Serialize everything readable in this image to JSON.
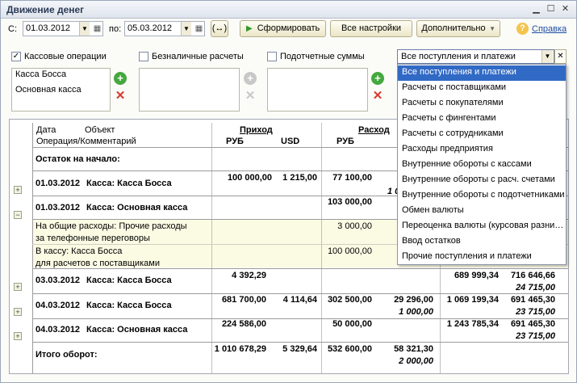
{
  "window": {
    "title": "Движение денег",
    "min_icon": "minimize-icon",
    "max_icon": "maximize-icon",
    "close_icon": "close-icon"
  },
  "toolbar": {
    "from_label": "С:",
    "from_date": "01.03.2012",
    "to_label": "по:",
    "to_date": "05.03.2012",
    "period_button": "(↔)",
    "generate_label": "Сформировать",
    "all_settings_label": "Все настройки",
    "additional_label": "Дополнительно",
    "help_label": "Справка"
  },
  "filters": {
    "cash_label": "Кассовые операции",
    "cash_checked": "✓",
    "cash_items": [
      "Касса Босса",
      "Основная касса"
    ],
    "noncash_label": "Безналичные расчеты",
    "accountable_label": "Подотчетные суммы",
    "combo_value": "Все поступления и платежи"
  },
  "dropdown": {
    "options": [
      "Все поступления и платежи",
      "Расчеты с поставщиками",
      "Расчеты с покупателями",
      "Расчеты с фингентами",
      "Расчеты с сотрудниками",
      "Расходы предприятия",
      "Внутренние обороты с кассами",
      "Внутренние обороты с расч. счетами",
      "Внутренние обороты с подотчетниками",
      "Обмен валюты",
      "Переоценка валюты (курсовая разни…",
      "Ввод остатков",
      "Прочие поступления и платежи"
    ]
  },
  "report": {
    "headers": {
      "date": "Дата",
      "object": "Объект",
      "operation": "Операция/Комментарий",
      "income": "Приход",
      "expense": "Расход",
      "rub": "РУБ",
      "usd": "USD",
      "rub2": "РУБ"
    },
    "opening": "Остаток на начало:",
    "rows": [
      {
        "date": "01.03.2012",
        "object": "Касса:  Касса Босса",
        "in_rub": "100 000,00",
        "in_usd": "1 215,00",
        "out_rub": "77 100,00",
        "extra": "1 0",
        "bal_rub": "",
        "bal_usd": "",
        "bal2": ""
      },
      {
        "date": "01.03.2012",
        "object": "Касса:  Основная касса",
        "in_rub": "",
        "in_usd": "",
        "out_rub": "103 000,00",
        "extra": "",
        "bal_rub": "",
        "bal_usd": "",
        "bal2": ""
      },
      {
        "date": "03.03.2012",
        "object": "Касса:  Касса Босса",
        "in_rub": "4 392,29",
        "in_usd": "",
        "out_rub": "",
        "extra": "",
        "bal_rub": "689 999,34",
        "bal_usd": "716 646,66",
        "bal2": "24 715,00"
      },
      {
        "date": "04.03.2012",
        "object": "Касса:  Касса Босса",
        "in_rub": "681 700,00",
        "in_usd": "4 114,64",
        "out_rub": "302 500,00",
        "extra": "29 296,00",
        "extra2": "1 000,00",
        "bal_rub": "1 069 199,34",
        "bal_usd": "691 465,30",
        "bal2": "23 715,00"
      },
      {
        "date": "04.03.2012",
        "object": "Касса:  Основная касса",
        "in_rub": "224 586,00",
        "in_usd": "",
        "out_rub": "50 000,00",
        "extra": "",
        "bal_rub": "1 243 785,34",
        "bal_usd": "691 465,30",
        "bal2": "23 715,00"
      }
    ],
    "details": [
      {
        "line1": "На общие расходы: Прочие расходы",
        "line2": "за телефонные переговоры",
        "out_rub": "3 000,00"
      },
      {
        "line1": "В кассу: Касса Босса",
        "line2": "для расчетов с поставщиками",
        "out_rub": "100 000,00"
      }
    ],
    "total": {
      "label": "Итого оборот:",
      "in_rub": "1 010 678,29",
      "in_usd": "5 329,64",
      "out_rub": "532 600,00",
      "extra": "58 321,30",
      "extra2": "2 000,00"
    }
  }
}
